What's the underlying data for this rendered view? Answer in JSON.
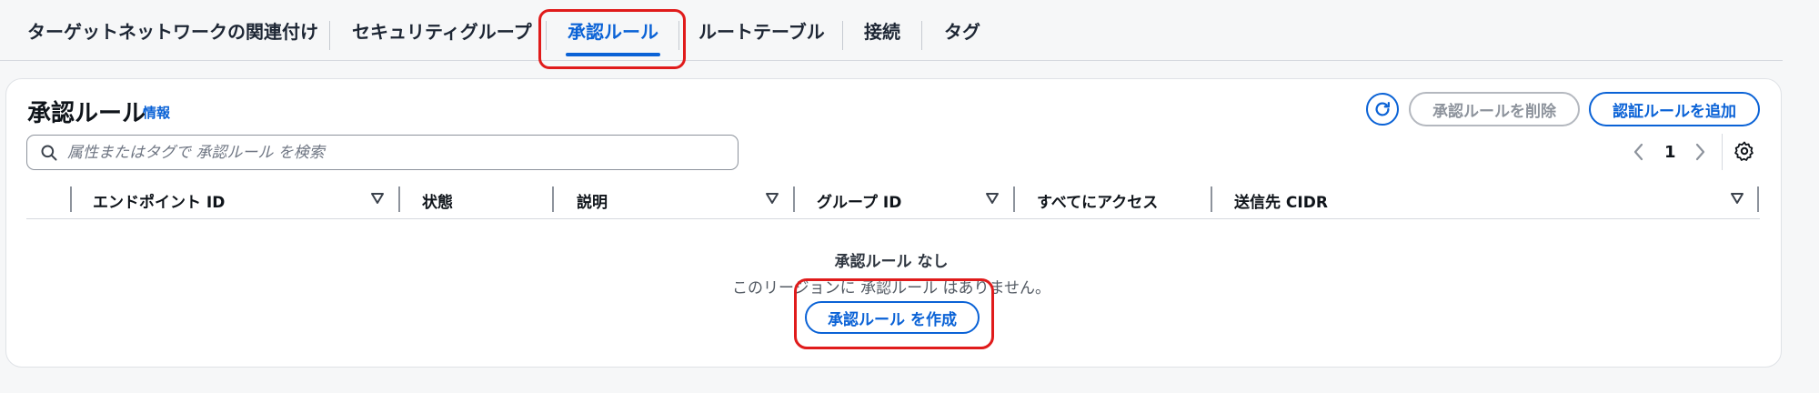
{
  "tabs": [
    {
      "label": "ターゲットネットワークの関連付け"
    },
    {
      "label": "セキュリティグループ"
    },
    {
      "label": "承認ルール"
    },
    {
      "label": "ルートテーブル"
    },
    {
      "label": "接続"
    },
    {
      "label": "タグ"
    }
  ],
  "active_tab": 2,
  "panel": {
    "title": "承認ルール",
    "info_link": "情報",
    "delete_button": "承認ルールを削除",
    "add_button": "認証ルールを追加",
    "search": {
      "placeholder": "属性またはタグで 承認ルール を検索"
    },
    "page_number": "1"
  },
  "table": {
    "columns": [
      {
        "label": "エンドポイント ID",
        "sortable": true
      },
      {
        "label": "状態",
        "sortable": false
      },
      {
        "label": "説明",
        "sortable": true
      },
      {
        "label": "グループ ID",
        "sortable": true
      },
      {
        "label": "すべてにアクセス",
        "sortable": false
      },
      {
        "label": "送信先 CIDR",
        "sortable": true
      }
    ]
  },
  "empty_state": {
    "title": "承認ルール なし",
    "description": "このリージョンに 承認ルール はありません。",
    "create_button": "承認ルール を作成"
  },
  "colors": {
    "accent": "#0a62d6",
    "highlight": "#e01b1b",
    "disabled": "#8d939c"
  },
  "icons": [
    "search-icon",
    "refresh-icon",
    "chevron-left-icon",
    "chevron-right-icon",
    "gear-icon",
    "sort-down-icon"
  ]
}
